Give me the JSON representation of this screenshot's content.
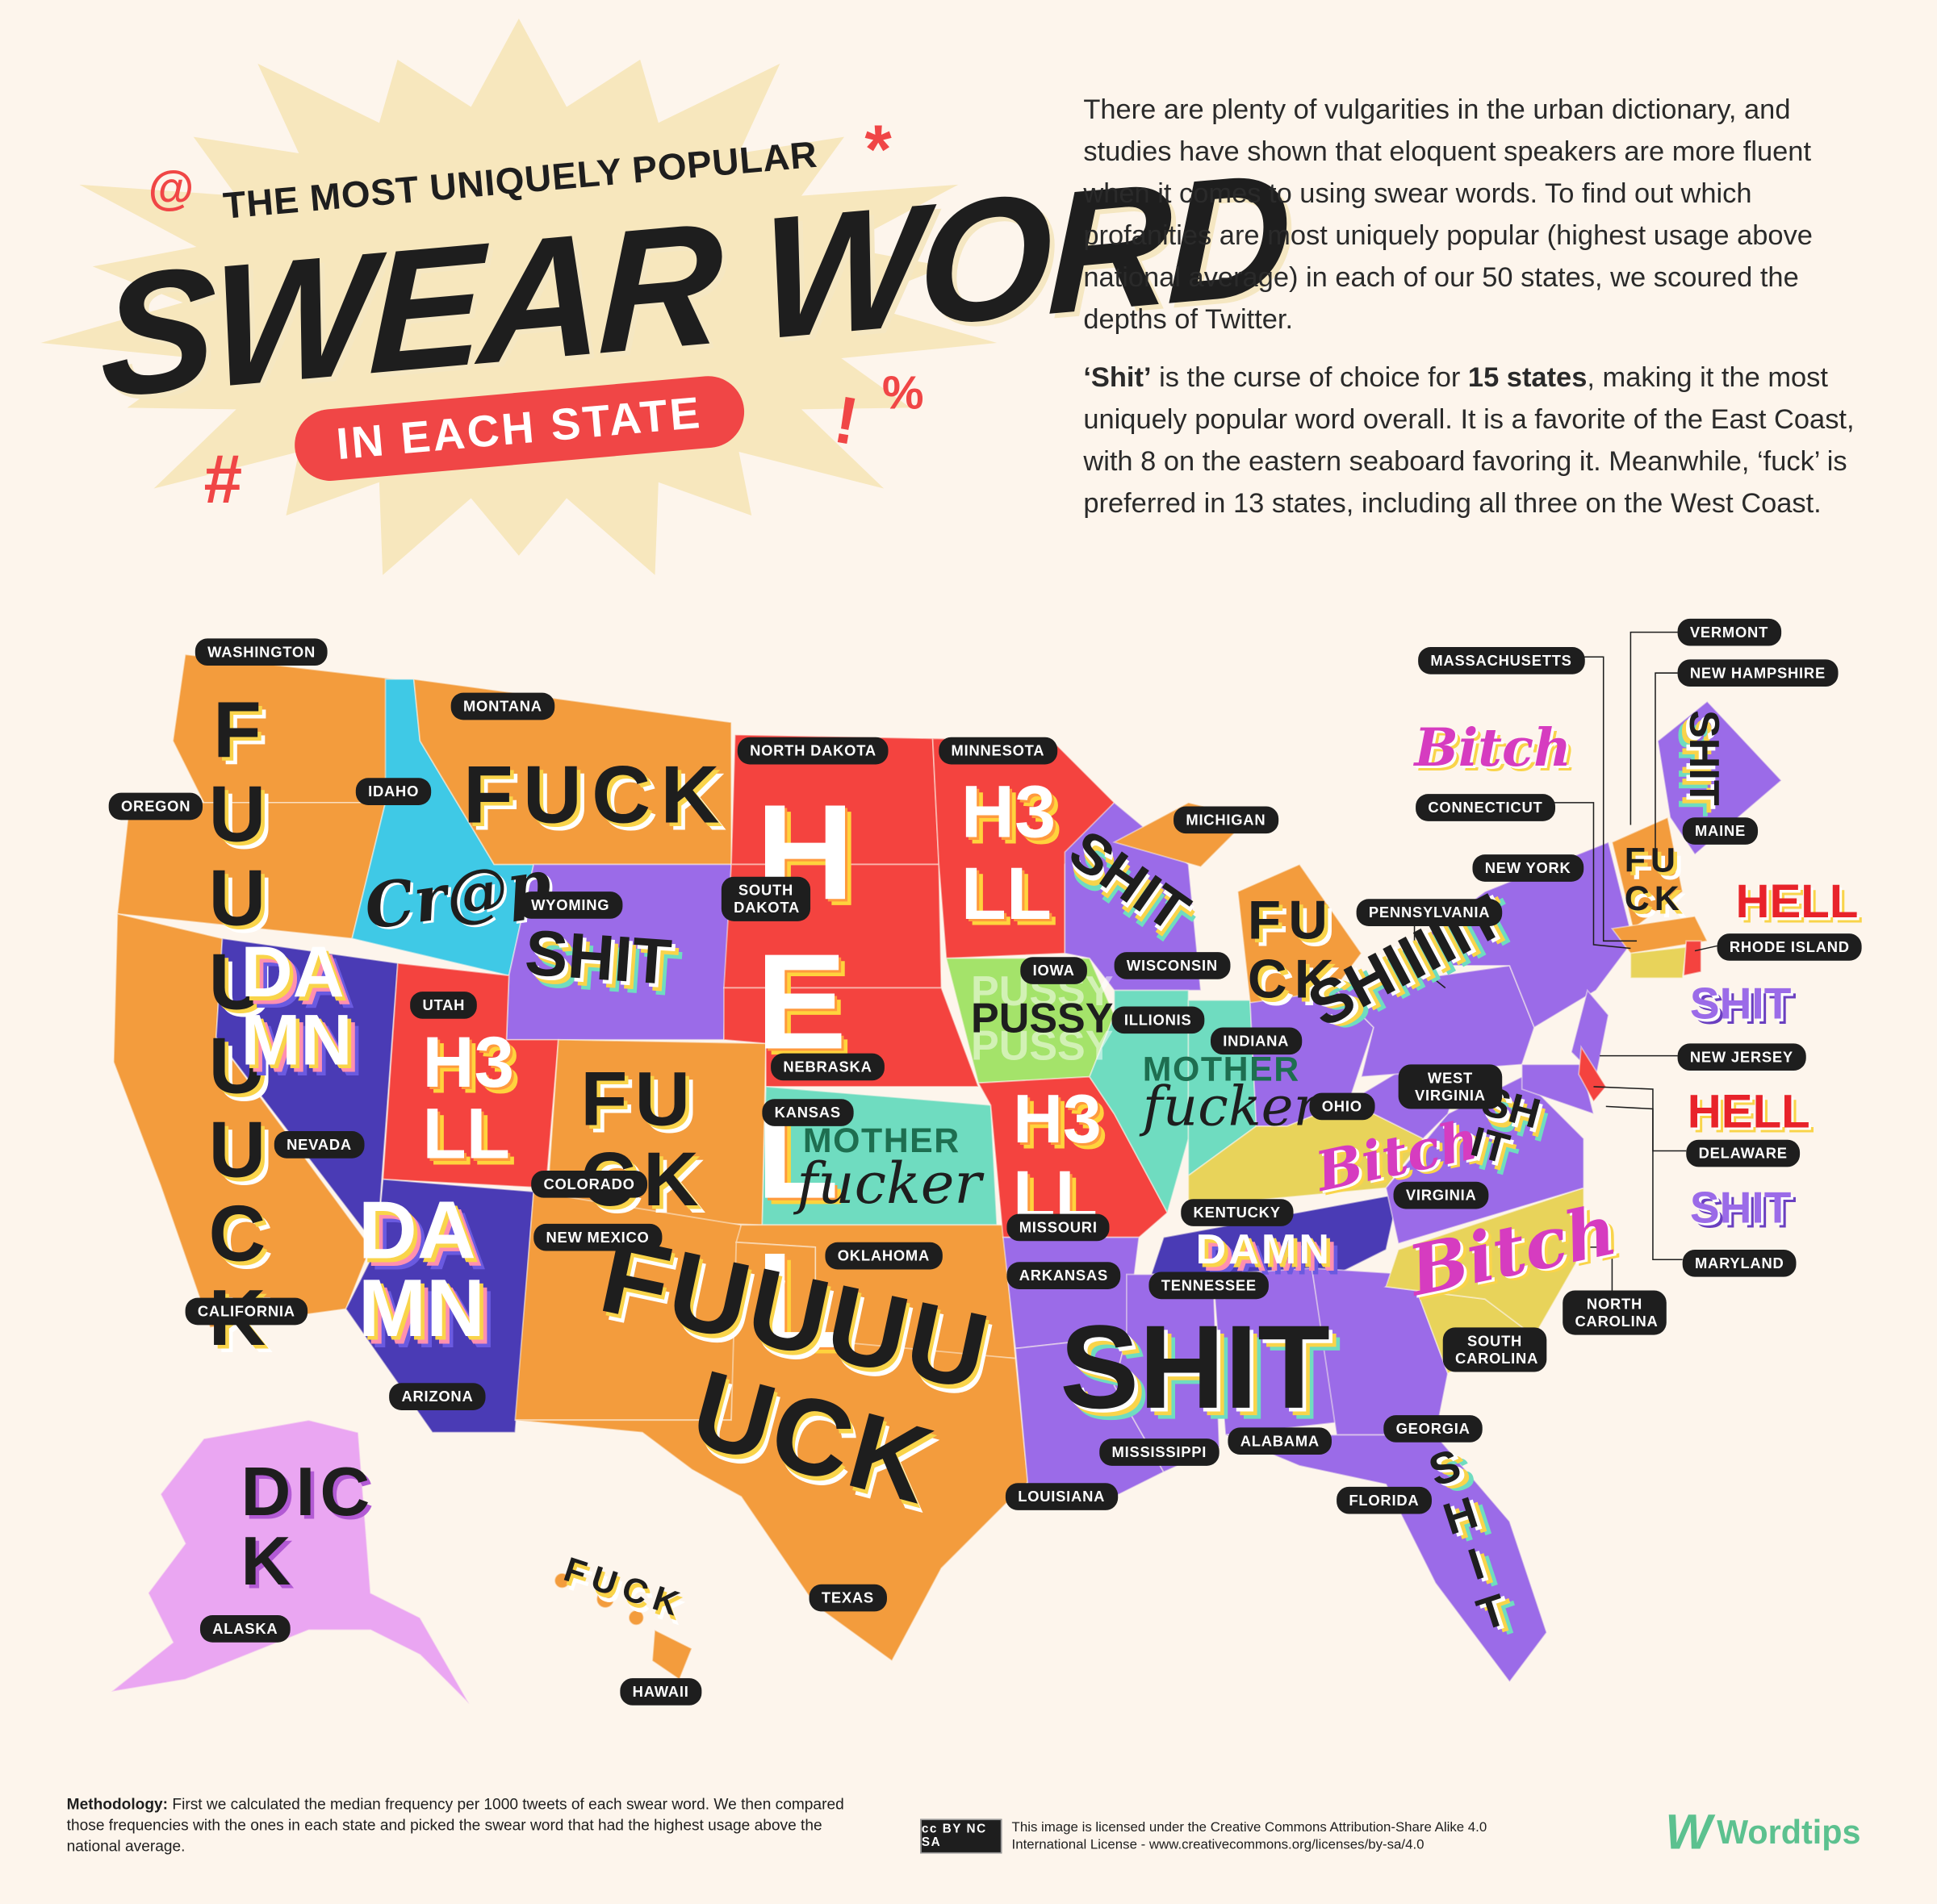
{
  "title": {
    "subtitle": "THE MOST UNIQUELY POPULAR",
    "main": "SWEAR WORD",
    "pill": "IN EACH STATE",
    "symbols": [
      "@",
      "*",
      "#",
      "!",
      "%"
    ]
  },
  "description": {
    "p1": "There are plenty of vulgarities in the urban dictionary, and studies have shown that eloquent speakers are more fluent when it comes to using swear words. To find out which profanities are most uniquely popular (highest usage above national average) in each of our 50 states, we scoured the depths of Twitter.",
    "p2_bold1": "‘Shit’",
    "p2_text1": " is the curse of choice for ",
    "p2_bold2": "15 states",
    "p2_text2": ", making it the most uniquely popular word overall. It is a favorite of the East Coast, with 8 on the eastern seaboard favoring it. Meanwhile, ‘fuck’ is preferred in 13 states, including all three on the West Coast."
  },
  "colors": {
    "background": "#fdf5ec",
    "fuck": "#f39c3d",
    "hell": "#f4433f",
    "shit": "#9b6be8",
    "damn": "#4a3bb5",
    "crap": "#3fc9e6",
    "motherfucker": "#6fdcc0",
    "pussy": "#a4e36a",
    "bitch": "#e8d35a",
    "dick": "#eaa6f2",
    "accent_red": "#f04646",
    "brand_green": "#5cc18f"
  },
  "map_words": {
    "west_coast": "FUUUUUCK",
    "montana": "FUCK",
    "idaho": "Cr@p",
    "wyoming": "SHIT",
    "nevada": "DAMN",
    "utah": "H3LL",
    "arizona": "DAMN",
    "colorado": "FUCK",
    "dakotas": "HELL",
    "minnesota": "H3LL",
    "iowa": "PUSSY",
    "missouri": "H3LL",
    "kansas_1": "MOTHER",
    "kansas_2": "fucker",
    "texas_1": "FUUUU",
    "texas_2": "UCK",
    "wisconsin": "SHIT",
    "michigan": "FUCK",
    "indiana_1": "MOTHER",
    "indiana_2": "fucker",
    "ohio_pa": "SHIIIIIT",
    "kentucky": "Bitch",
    "tennessee": "DAMN",
    "virginia": "SHIT",
    "carolinas": "Bitch",
    "south": "SHIT",
    "florida": "SHIT",
    "maine": "SHIT",
    "connecticut": "Bitch",
    "new_england": "FUCK",
    "rhode_island": "HELL",
    "new_jersey": "SHIT",
    "delaware": "HELL",
    "maryland": "SHIT",
    "alaska": "DICK",
    "hawaii": "FUCK"
  },
  "states": {
    "washington": "WASHINGTON",
    "montana": "MONTANA",
    "oregon": "OREGON",
    "idaho": "IDAHO",
    "north_dakota": "NORTH DAKOTA",
    "minnesota": "MINNESOTA",
    "south_dakota": "SOUTH DAKOTA",
    "wyoming": "WYOMING",
    "michigan": "MICHIGAN",
    "iowa": "IOWA",
    "wisconsin": "WISCONSIN",
    "utah": "UTAH",
    "illinois": "ILLIONIS",
    "indiana": "INDIANA",
    "nebraska": "NEBRASKA",
    "ohio": "OHIO",
    "west_virginia": "WEST VIRGINIA",
    "nevada": "NEVADA",
    "kansas": "KANSAS",
    "colorado": "COLORADO",
    "kentucky": "KENTUCKY",
    "missouri": "MISSOURI",
    "new_mexico": "NEW MEXICO",
    "oklahoma": "OKLAHOMA",
    "virginia": "VIRGINIA",
    "arkansas": "ARKANSAS",
    "tennessee": "TENNESSEE",
    "california": "CALIFORNIA",
    "north_carolina": "NORTH CAROLINA",
    "south_carolina": "SOUTH CAROLINA",
    "arizona": "ARIZONA",
    "georgia": "GEORGIA",
    "alabama": "ALABAMA",
    "mississippi": "MISSISSIPPI",
    "louisiana": "LOUISIANA",
    "florida": "FLORIDA",
    "texas": "TEXAS",
    "alaska": "ALASKA",
    "hawaii": "HAWAII",
    "massachusetts": "MASSACHUSETTS",
    "vermont": "VERMONT",
    "new_hampshire": "NEW HAMPSHIRE",
    "connecticut": "CONNECTICUT",
    "maine": "MAINE",
    "new_york": "NEW YORK",
    "pennsylvania": "PENNSYLVANIA",
    "rhode_island": "RHODE ISLAND",
    "new_jersey": "NEW JERSEY",
    "delaware": "DELAWARE",
    "maryland": "MARYLAND"
  },
  "footer": {
    "methodology_label": "Methodology:",
    "methodology_text": " First we calculated the median frequency per 1000 tweets of each swear word. We then compared those frequencies with the ones in each state and picked the swear word that had the highest usage above the national average.",
    "cc_badge": "cc BY NC SA",
    "license": "This image is licensed under the Creative Commons Attribution-Share Alike 4.0 International License - www.creativecommons.org/licenses/by-sa/4.0",
    "brand": "Wordtips"
  }
}
